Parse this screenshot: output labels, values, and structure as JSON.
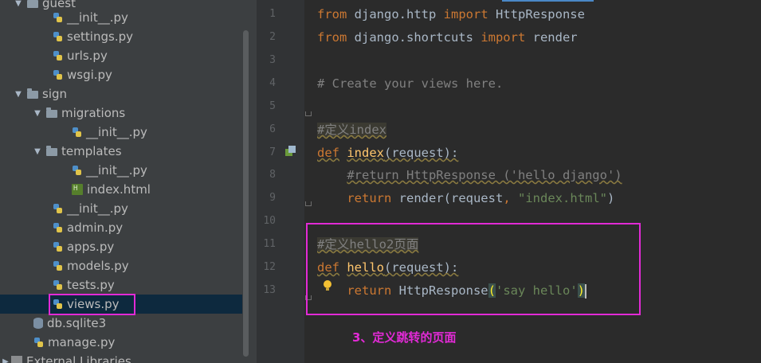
{
  "project_tree": {
    "items": [
      {
        "label": "guest",
        "icon": "folder-icon",
        "expanded": true
      },
      {
        "label": "__init__.py",
        "icon": "python-file-icon"
      },
      {
        "label": "settings.py",
        "icon": "python-file-icon"
      },
      {
        "label": "urls.py",
        "icon": "python-file-icon"
      },
      {
        "label": "wsgi.py",
        "icon": "python-file-icon"
      },
      {
        "label": "sign",
        "icon": "folder-icon",
        "expanded": true
      },
      {
        "label": "migrations",
        "icon": "folder-icon",
        "expanded": true
      },
      {
        "label": "__init__.py",
        "icon": "python-file-icon"
      },
      {
        "label": "templates",
        "icon": "folder-icon",
        "expanded": true
      },
      {
        "label": "__init__.py",
        "icon": "python-file-icon"
      },
      {
        "label": "index.html",
        "icon": "html-file-icon"
      },
      {
        "label": "__init__.py",
        "icon": "python-file-icon"
      },
      {
        "label": "admin.py",
        "icon": "python-file-icon"
      },
      {
        "label": "apps.py",
        "icon": "python-file-icon"
      },
      {
        "label": "models.py",
        "icon": "python-file-icon"
      },
      {
        "label": "tests.py",
        "icon": "python-file-icon"
      },
      {
        "label": "views.py",
        "icon": "python-file-icon",
        "selected": true
      },
      {
        "label": "db.sqlite3",
        "icon": "database-icon"
      },
      {
        "label": "manage.py",
        "icon": "python-file-icon"
      },
      {
        "label": "External Libraries",
        "icon": "library-icon",
        "collapsed": true
      }
    ]
  },
  "editor": {
    "line_numbers": [
      "1",
      "2",
      "3",
      "4",
      "5",
      "6",
      "7",
      "8",
      "9",
      "10",
      "11",
      "12",
      "13"
    ],
    "lines": {
      "l1": {
        "kw1": "from",
        "mod": " django.http ",
        "kw2": "import",
        "name": " HttpResponse"
      },
      "l2": {
        "kw1": "from",
        "mod": " django.shortcuts ",
        "kw2": "import",
        "name": " render"
      },
      "l4": {
        "comment": "# Create your views here."
      },
      "l6": {
        "comment": "#定义index"
      },
      "l7": {
        "kw": "def",
        "sp": " ",
        "fn": "index",
        "args": "(request):"
      },
      "l8": {
        "indent": "    ",
        "comment": "#return HttpResponse ('hello django')"
      },
      "l9": {
        "indent": "    ",
        "kw": "return",
        "call": " render(request",
        "comma": ",",
        "sp": " ",
        "str": "\"index.html\"",
        "close": ")"
      },
      "l11": {
        "comment": "#定义hello2页面"
      },
      "l12": {
        "kw": "def",
        "sp": " ",
        "fn": "hello",
        "args": "(request):"
      },
      "l13": {
        "indent": "    ",
        "kw": "return",
        "call": " HttpResponse",
        "open": "(",
        "str": "'say hello'",
        "close": ")"
      }
    }
  },
  "annotation": {
    "text": "3、定义跳转的页面"
  },
  "colors": {
    "highlight_box": "#e22ad6",
    "keyword": "#cc7832",
    "string": "#6a8759",
    "comment": "#808080",
    "function": "#ffc66d"
  }
}
